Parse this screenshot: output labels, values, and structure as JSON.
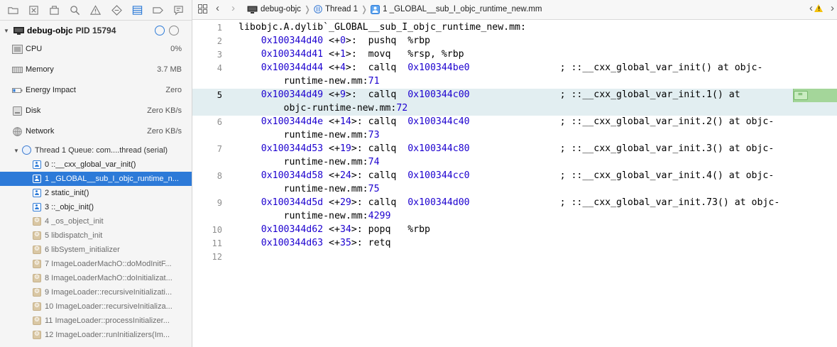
{
  "navigator": {
    "process": {
      "name": "debug-objc",
      "pid": "PID 15794"
    },
    "gauges": [
      {
        "label": "CPU",
        "value": "0%"
      },
      {
        "label": "Memory",
        "value": "3.7 MB"
      },
      {
        "label": "Energy Impact",
        "value": "Zero"
      },
      {
        "label": "Disk",
        "value": "Zero KB/s"
      },
      {
        "label": "Network",
        "value": "Zero KB/s"
      }
    ],
    "thread": {
      "label": "Thread 1 Queue: com....thread (serial)"
    },
    "frames": [
      {
        "label": "0 ::__cxx_global_var_init()",
        "kind": "user"
      },
      {
        "label": "1 _GLOBAL__sub_I_objc_runtime_n...",
        "kind": "user",
        "selected": true
      },
      {
        "label": "2 static_init()",
        "kind": "user"
      },
      {
        "label": "3 ::_objc_init()",
        "kind": "user"
      },
      {
        "label": "4 _os_object_init",
        "kind": "sys"
      },
      {
        "label": "5 libdispatch_init",
        "kind": "sys"
      },
      {
        "label": "6 libSystem_initializer",
        "kind": "sys"
      },
      {
        "label": "7 ImageLoaderMachO::doModInitF...",
        "kind": "sys"
      },
      {
        "label": "8 ImageLoaderMachO::doInitializat...",
        "kind": "sys"
      },
      {
        "label": "9 ImageLoader::recursiveInitializati...",
        "kind": "sys"
      },
      {
        "label": "10 ImageLoader::recursiveInitializa...",
        "kind": "sys"
      },
      {
        "label": "11 ImageLoader::processInitializer...",
        "kind": "sys"
      },
      {
        "label": "12 ImageLoader::runInitializers(Im...",
        "kind": "sys"
      }
    ]
  },
  "jumpbar": {
    "crumbs": [
      "debug-objc",
      "Thread 1",
      "1 _GLOBAL__sub_I_objc_runtime_new.mm"
    ]
  },
  "code": {
    "highlight_line": "5",
    "lines": [
      {
        "n": "1",
        "parts": [
          {
            "t": "libobjc.A.dylib`_GLOBAL__sub_I_objc_runtime_new.mm:",
            "c": ""
          }
        ]
      },
      {
        "n": "2",
        "parts": [
          {
            "t": "    ",
            "c": ""
          },
          {
            "t": "0x100344d40",
            "c": "addr"
          },
          {
            "t": " <+",
            "c": ""
          },
          {
            "t": "0",
            "c": "lit"
          },
          {
            "t": ">:  pushq  %rbp",
            "c": ""
          }
        ]
      },
      {
        "n": "3",
        "parts": [
          {
            "t": "    ",
            "c": ""
          },
          {
            "t": "0x100344d41",
            "c": "addr"
          },
          {
            "t": " <+",
            "c": ""
          },
          {
            "t": "1",
            "c": "lit"
          },
          {
            "t": ">:  movq   %rsp, %rbp",
            "c": ""
          }
        ]
      },
      {
        "n": "4",
        "parts": [
          {
            "t": "    ",
            "c": ""
          },
          {
            "t": "0x100344d44",
            "c": "addr"
          },
          {
            "t": " <+",
            "c": ""
          },
          {
            "t": "4",
            "c": "lit"
          },
          {
            "t": ">:  callq  ",
            "c": ""
          },
          {
            "t": "0x100344be0",
            "c": "addr"
          },
          {
            "t": "                ; ::__cxx_global_var_init() at objc-",
            "c": ""
          }
        ],
        "cont": [
          {
            "t": "        runtime-new.mm:",
            "c": ""
          },
          {
            "t": "71",
            "c": "lit"
          }
        ]
      },
      {
        "n": "5",
        "parts": [
          {
            "t": "    ",
            "c": ""
          },
          {
            "t": "0x100344d49",
            "c": "addr"
          },
          {
            "t": " <+",
            "c": ""
          },
          {
            "t": "9",
            "c": "lit"
          },
          {
            "t": ">:  callq  ",
            "c": ""
          },
          {
            "t": "0x100344c00",
            "c": "addr"
          },
          {
            "t": "                ; ::__cxx_global_var_init.1() at",
            "c": ""
          }
        ],
        "cont": [
          {
            "t": "        objc-runtime-new.mm:",
            "c": ""
          },
          {
            "t": "72",
            "c": "lit"
          }
        ]
      },
      {
        "n": "6",
        "parts": [
          {
            "t": "    ",
            "c": ""
          },
          {
            "t": "0x100344d4e",
            "c": "addr"
          },
          {
            "t": " <+",
            "c": ""
          },
          {
            "t": "14",
            "c": "lit"
          },
          {
            "t": ">: callq  ",
            "c": ""
          },
          {
            "t": "0x100344c40",
            "c": "addr"
          },
          {
            "t": "                ; ::__cxx_global_var_init.2() at objc-",
            "c": ""
          }
        ],
        "cont": [
          {
            "t": "        runtime-new.mm:",
            "c": ""
          },
          {
            "t": "73",
            "c": "lit"
          }
        ]
      },
      {
        "n": "7",
        "parts": [
          {
            "t": "    ",
            "c": ""
          },
          {
            "t": "0x100344d53",
            "c": "addr"
          },
          {
            "t": " <+",
            "c": ""
          },
          {
            "t": "19",
            "c": "lit"
          },
          {
            "t": ">: callq  ",
            "c": ""
          },
          {
            "t": "0x100344c80",
            "c": "addr"
          },
          {
            "t": "                ; ::__cxx_global_var_init.3() at objc-",
            "c": ""
          }
        ],
        "cont": [
          {
            "t": "        runtime-new.mm:",
            "c": ""
          },
          {
            "t": "74",
            "c": "lit"
          }
        ]
      },
      {
        "n": "8",
        "parts": [
          {
            "t": "    ",
            "c": ""
          },
          {
            "t": "0x100344d58",
            "c": "addr"
          },
          {
            "t": " <+",
            "c": ""
          },
          {
            "t": "24",
            "c": "lit"
          },
          {
            "t": ">: callq  ",
            "c": ""
          },
          {
            "t": "0x100344cc0",
            "c": "addr"
          },
          {
            "t": "                ; ::__cxx_global_var_init.4() at objc-",
            "c": ""
          }
        ],
        "cont": [
          {
            "t": "        runtime-new.mm:",
            "c": ""
          },
          {
            "t": "75",
            "c": "lit"
          }
        ]
      },
      {
        "n": "9",
        "parts": [
          {
            "t": "    ",
            "c": ""
          },
          {
            "t": "0x100344d5d",
            "c": "addr"
          },
          {
            "t": " <+",
            "c": ""
          },
          {
            "t": "29",
            "c": "lit"
          },
          {
            "t": ">: callq  ",
            "c": ""
          },
          {
            "t": "0x100344d00",
            "c": "addr"
          },
          {
            "t": "                ; ::__cxx_global_var_init.73() at objc-",
            "c": ""
          }
        ],
        "cont": [
          {
            "t": "        runtime-new.mm:",
            "c": ""
          },
          {
            "t": "4299",
            "c": "lit"
          }
        ]
      },
      {
        "n": "10",
        "parts": [
          {
            "t": "    ",
            "c": ""
          },
          {
            "t": "0x100344d62",
            "c": "addr"
          },
          {
            "t": " <+",
            "c": ""
          },
          {
            "t": "34",
            "c": "lit"
          },
          {
            "t": ">: popq   %rbp",
            "c": ""
          }
        ]
      },
      {
        "n": "11",
        "parts": [
          {
            "t": "    ",
            "c": ""
          },
          {
            "t": "0x100344d63",
            "c": "addr"
          },
          {
            "t": " <+",
            "c": ""
          },
          {
            "t": "35",
            "c": "lit"
          },
          {
            "t": ">: retq",
            "c": ""
          }
        ]
      },
      {
        "n": "12",
        "parts": []
      }
    ]
  },
  "colors": {
    "selection": "#2d7ad8",
    "address": "#1c00cf",
    "pc_highlight": "#e2eef1",
    "pc_marker": "#a4d69a",
    "warning": "#f4c20d"
  },
  "icons": [
    "folder-icon",
    "source-control-icon",
    "symbol-icon",
    "search-icon",
    "issue-icon",
    "test-icon",
    "debug-icon",
    "breakpoint-icon",
    "report-icon",
    "grid-icon",
    "warning-icon",
    "thread-icon",
    "monitor-icon",
    "gauge-icon"
  ]
}
